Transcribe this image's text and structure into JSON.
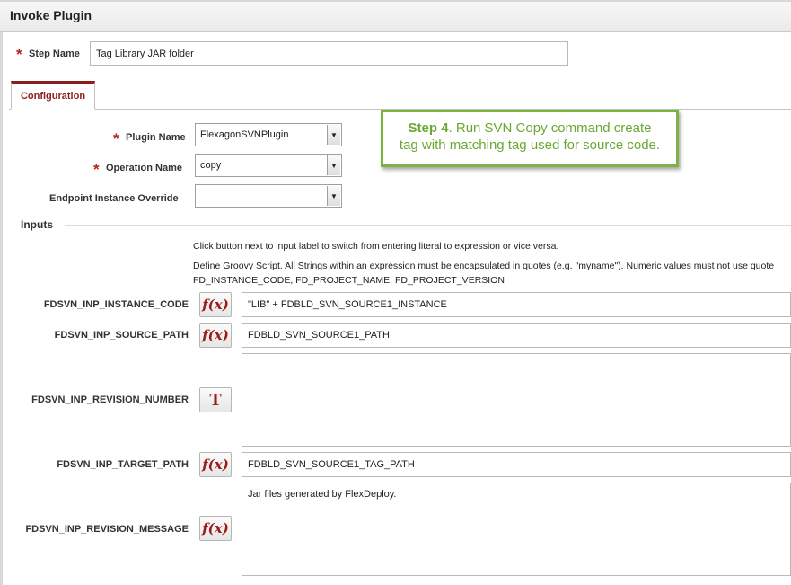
{
  "dialog": {
    "title": "Invoke Plugin"
  },
  "step": {
    "label": "Step Name",
    "value": "Tag Library JAR folder"
  },
  "tabs": [
    {
      "label": "Configuration"
    }
  ],
  "config": {
    "plugin_name": {
      "label": "Plugin Name",
      "value": "FlexagonSVNPlugin"
    },
    "operation_name": {
      "label": "Operation Name",
      "value": "copy"
    },
    "endpoint_override": {
      "label": "Endpoint Instance Override",
      "value": ""
    }
  },
  "callout": {
    "step": "Step 4",
    "text_line1": ". Run SVN Copy command create",
    "text_line2": "tag with matching tag used for source code."
  },
  "inputs": {
    "title": "Inputs",
    "hint1": "Click button next to input label to switch from entering literal to expression or vice versa.",
    "hint2": "Define Groovy Script. All Strings within an expression must be encapsulated in quotes (e.g. \"myname\"). Numeric values must not use quote",
    "hint3": "FD_INSTANCE_CODE, FD_PROJECT_NAME, FD_PROJECT_VERSION",
    "fields": [
      {
        "label": "FDSVN_INP_INSTANCE_CODE",
        "mode": "f(x)",
        "value": "\"LIB\" + FDBLD_SVN_SOURCE1_INSTANCE"
      },
      {
        "label": "FDSVN_INP_SOURCE_PATH",
        "mode": "f(x)",
        "value": "FDBLD_SVN_SOURCE1_PATH"
      },
      {
        "label": "FDSVN_INP_REVISION_NUMBER",
        "mode": "T",
        "value": ""
      },
      {
        "label": "FDSVN_INP_TARGET_PATH",
        "mode": "f(x)",
        "value": "FDBLD_SVN_SOURCE1_TAG_PATH"
      },
      {
        "label": "FDSVN_INP_REVISION_MESSAGE",
        "mode": "f(x)",
        "value": "Jar files generated by FlexDeploy."
      }
    ]
  }
}
